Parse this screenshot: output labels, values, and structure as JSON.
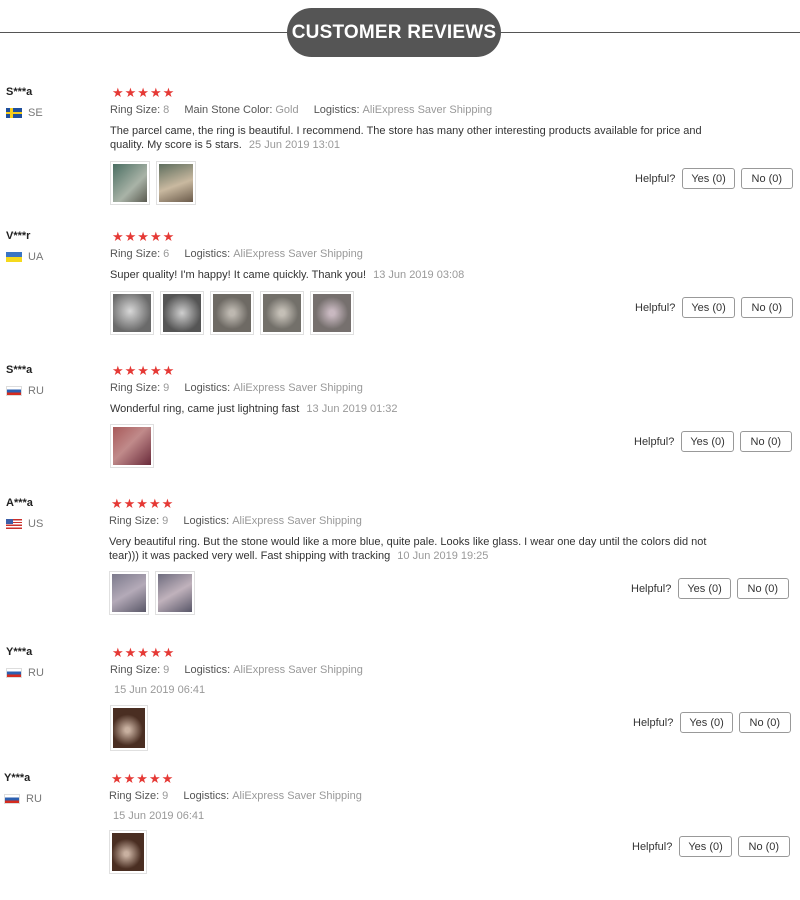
{
  "header": {
    "title": "CUSTOMER REVIEWS"
  },
  "labels": {
    "ring_size": "Ring Size:",
    "main_stone_color": "Main Stone Color:",
    "logistics": "Logistics:",
    "helpful": "Helpful?",
    "stars": "★★★★★"
  },
  "colors": {
    "stars": "#e53935",
    "header_pill": "#555555",
    "muted_text": "#999999"
  },
  "reviews": [
    {
      "user": "S***a",
      "country": "SE",
      "flag": "sweden-flag-icon",
      "rating": 5,
      "ring_size": "8",
      "main_stone_color": "Gold",
      "logistics": "AliExpress Saver Shipping",
      "text": "The parcel came, the ring is beautiful. I recommend. The store has many other interesting products available for price and quality. My score is 5 stars.",
      "date": "25 Jun 2019 13:01",
      "photos": [
        "ring-photo-1",
        "ring-photo-2"
      ],
      "yes": "Yes (0)",
      "no": "No (0)"
    },
    {
      "user": "V***r",
      "country": "UA",
      "flag": "ukraine-flag-icon",
      "rating": 5,
      "ring_size": "6",
      "logistics": "AliExpress Saver Shipping",
      "text": "Super quality! I'm happy! It came quickly. Thank you!",
      "date": "13 Jun 2019 03:08",
      "photos": [
        "ring-photo-1",
        "ring-photo-2",
        "ring-photo-3",
        "ring-photo-4",
        "ring-photo-5"
      ],
      "yes": "Yes (0)",
      "no": "No (0)"
    },
    {
      "user": "S***a",
      "country": "RU",
      "flag": "russia-flag-icon",
      "rating": 5,
      "ring_size": "9",
      "logistics": "AliExpress Saver Shipping",
      "text": "Wonderful ring, came just lightning fast",
      "date": "13 Jun 2019 01:32",
      "photos": [
        "ring-photo-1"
      ],
      "yes": "Yes (0)",
      "no": "No (0)"
    },
    {
      "user": "A***a",
      "country": "US",
      "flag": "usa-flag-icon",
      "rating": 5,
      "ring_size": "9",
      "logistics": "AliExpress Saver Shipping",
      "text": "Very beautiful ring. But the stone would like a more blue, quite pale. Looks like glass. I wear one day until the colors did not tear))) it was packed very well. Fast shipping with tracking",
      "date": "10 Jun 2019 19:25",
      "photos": [
        "ring-photo-1",
        "ring-photo-2"
      ],
      "yes": "Yes (0)",
      "no": "No (0)"
    },
    {
      "user": "Y***a",
      "country": "RU",
      "flag": "russia-flag-icon",
      "rating": 5,
      "ring_size": "9",
      "logistics": "AliExpress Saver Shipping",
      "text": "",
      "date": "15 Jun 2019 06:41",
      "photos": [
        "ring-photo-1"
      ],
      "yes": "Yes (0)",
      "no": "No (0)"
    },
    {
      "user": "Y***a",
      "country": "RU",
      "flag": "russia-flag-icon",
      "rating": 5,
      "ring_size": "9",
      "logistics": "AliExpress Saver Shipping",
      "text": "",
      "date": "15 Jun 2019 06:41",
      "photos": [
        "ring-photo-1"
      ],
      "yes": "Yes (0)",
      "no": "No (0)"
    }
  ]
}
